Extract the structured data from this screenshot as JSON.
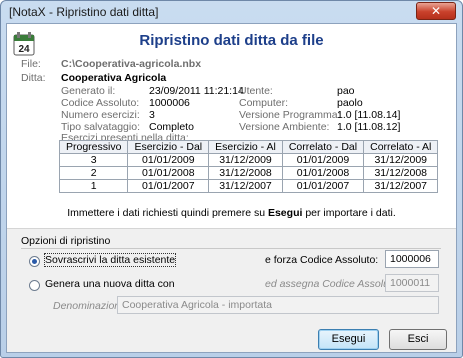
{
  "window": {
    "title": "[NotaX - Ripristino dati ditta]",
    "close_label": "✕"
  },
  "header": {
    "title": "Ripristino dati ditta da file",
    "icon": "calendar-24-icon"
  },
  "info": {
    "file_label": "File:",
    "file_value": "C:\\Cooperativa-agricola.nbx",
    "ditta_label": "Ditta:",
    "ditta_value": "Cooperativa Agricola",
    "generato_label": "Generato il:",
    "generato_value": "23/09/2011 11:21:14",
    "codice_label": "Codice Assoluto:",
    "codice_value": "1000006",
    "numero_label": "Numero esercizi:",
    "numero_value": "3",
    "tipo_label": "Tipo salvataggio:",
    "tipo_value": "Completo",
    "utente_label": "Utente:",
    "utente_value": "pao",
    "computer_label": "Computer:",
    "computer_value": "paolo",
    "vprog_label": "Versione Programma:",
    "vprog_value": "1.0 [11.08.14]",
    "vamb_label": "Versione Ambiente:",
    "vamb_value": "1.0 [11.08.12]",
    "esercizi_label": "Esercizi presenti nella ditta:"
  },
  "esercizi_table": {
    "headers": [
      "Progressivo",
      "Esercizio - Dal",
      "Esercizio - Al",
      "Correlato - Dal",
      "Correlato - Al"
    ],
    "rows": [
      [
        "3",
        "01/01/2009",
        "31/12/2009",
        "01/01/2009",
        "31/12/2009"
      ],
      [
        "2",
        "01/01/2008",
        "31/12/2008",
        "01/01/2008",
        "31/12/2008"
      ],
      [
        "1",
        "01/01/2007",
        "31/12/2007",
        "01/01/2007",
        "31/12/2007"
      ]
    ]
  },
  "note": {
    "prefix": "Immettere i dati richiesti quindi premere su ",
    "action": "Esegui",
    "suffix": " per importare i dati."
  },
  "options": {
    "title": "Opzioni di ripristino",
    "overwrite_label": "Sovrascrivi la ditta esistente",
    "overwrite_selected": true,
    "force_label": "e forza Codice Assoluto:",
    "force_value": "1000006",
    "new_label": "Genera una nuova ditta con",
    "assign_label": "ed assegna Codice Assoluto:",
    "assign_value": "1000011",
    "denom_label": "Denominazione:",
    "denom_value": "Cooperativa Agricola - importata"
  },
  "buttons": {
    "run": "Esegui",
    "exit": "Esci"
  }
}
